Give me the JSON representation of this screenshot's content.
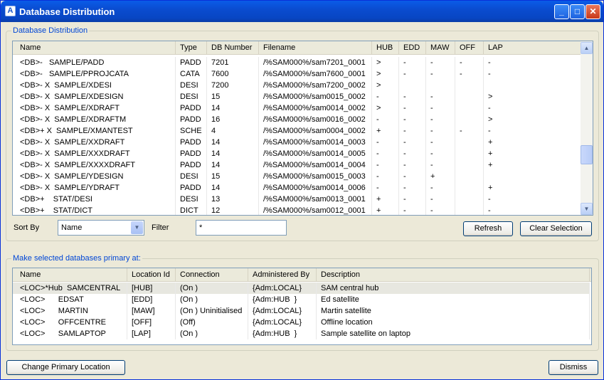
{
  "window": {
    "title": "Database Distribution",
    "icon": "app-icon"
  },
  "title_buttons": {
    "minimize": "_",
    "maximize": "□",
    "close": "✕"
  },
  "db_group": {
    "label": "Database Distribution",
    "columns": [
      "Name",
      "Type",
      "DB Number",
      "Filename",
      "HUB",
      "EDD",
      "MAW",
      "OFF",
      "LAP"
    ],
    "rows": [
      [
        "<DB>-   SAMPLE/PADD",
        "PADD",
        "7201",
        "/%SAM000%/sam7201_0001",
        ">",
        "-",
        "-",
        "-",
        "-"
      ],
      [
        "<DB>-   SAMPLE/PPROJCATA",
        "CATA",
        "7600",
        "/%SAM000%/sam7600_0001",
        ">",
        "-",
        "-",
        "-",
        "-"
      ],
      [
        "<DB>- X  SAMPLE/XDESI",
        "DESI",
        "7200",
        "/%SAM000%/sam7200_0002",
        ">",
        "",
        "",
        "",
        ""
      ],
      [
        "<DB>- X  SAMPLE/XDESIGN",
        "DESI",
        "15",
        "/%SAM000%/sam0015_0002",
        "-",
        "-",
        "-",
        "",
        ">"
      ],
      [
        "<DB>- X  SAMPLE/XDRAFT",
        "PADD",
        "14",
        "/%SAM000%/sam0014_0002",
        ">",
        "-",
        "-",
        "",
        "-"
      ],
      [
        "<DB>- X  SAMPLE/XDRAFTM",
        "PADD",
        "16",
        "/%SAM000%/sam0016_0002",
        "-",
        "-",
        "-",
        "",
        ">"
      ],
      [
        "<DB>+ X  SAMPLE/XMANTEST",
        "SCHE",
        "4",
        "/%SAM000%/sam0004_0002",
        "+",
        "-",
        "-",
        "-",
        "-"
      ],
      [
        "<DB>- X  SAMPLE/XXDRAFT",
        "PADD",
        "14",
        "/%SAM000%/sam0014_0003",
        "-",
        "-",
        "-",
        "",
        "+"
      ],
      [
        "<DB>- X  SAMPLE/XXXDRAFT",
        "PADD",
        "14",
        "/%SAM000%/sam0014_0005",
        "-",
        "-",
        "-",
        "",
        "+"
      ],
      [
        "<DB>- X  SAMPLE/XXXXDRAFT",
        "PADD",
        "14",
        "/%SAM000%/sam0014_0004",
        "-",
        "-",
        "-",
        "",
        "+"
      ],
      [
        "<DB>- X  SAMPLE/YDESIGN",
        "DESI",
        "15",
        "/%SAM000%/sam0015_0003",
        "-",
        "-",
        "+",
        "",
        ""
      ],
      [
        "<DB>- X  SAMPLE/YDRAFT",
        "PADD",
        "14",
        "/%SAM000%/sam0014_0006",
        "-",
        "-",
        "-",
        "",
        "+"
      ],
      [
        "<DB>+    STAT/DESI",
        "DESI",
        "13",
        "/%SAM000%/sam0013_0001",
        "+",
        "-",
        "-",
        "",
        "-"
      ],
      [
        "<DB>+    STAT/DICT",
        "DICT",
        "12",
        "/%SAM000%/sam0012_0001",
        "+",
        "-",
        "-",
        "",
        "-"
      ]
    ],
    "scroll_up": "▲",
    "scroll_down": "▼"
  },
  "sort": {
    "label": "Sort By",
    "value": "Name",
    "arrow": "▼"
  },
  "filter": {
    "label": "Filter",
    "value": "*"
  },
  "buttons": {
    "refresh": "Refresh",
    "clear_selection": "Clear Selection",
    "change_primary": "Change Primary Location",
    "dismiss": "Dismiss"
  },
  "loc_group": {
    "label": "Make selected databases primary at:",
    "columns": [
      "Name",
      "Location Id",
      "Connection",
      "Administered By",
      "Description"
    ],
    "rows": [
      [
        "<LOC>*Hub  SAMCENTRAL",
        "[HUB]",
        "(On )",
        "{Adm:LOCAL}",
        "SAM central hub"
      ],
      [
        "<LOC>      EDSAT",
        "[EDD]",
        "(On )",
        "{Adm:HUB  }",
        "Ed satellite"
      ],
      [
        "<LOC>      MARTIN",
        "[MAW]",
        "(On ) Uninitialised",
        "{Adm:LOCAL}",
        "Martin satellite"
      ],
      [
        "<LOC>      OFFCENTRE",
        "[OFF]",
        "(Off)",
        "{Adm:LOCAL}",
        "Offline location"
      ],
      [
        "<LOC>      SAMLAPTOP",
        "[LAP]",
        "(On )",
        "{Adm:HUB  }",
        "Sample satellite on laptop"
      ]
    ]
  }
}
